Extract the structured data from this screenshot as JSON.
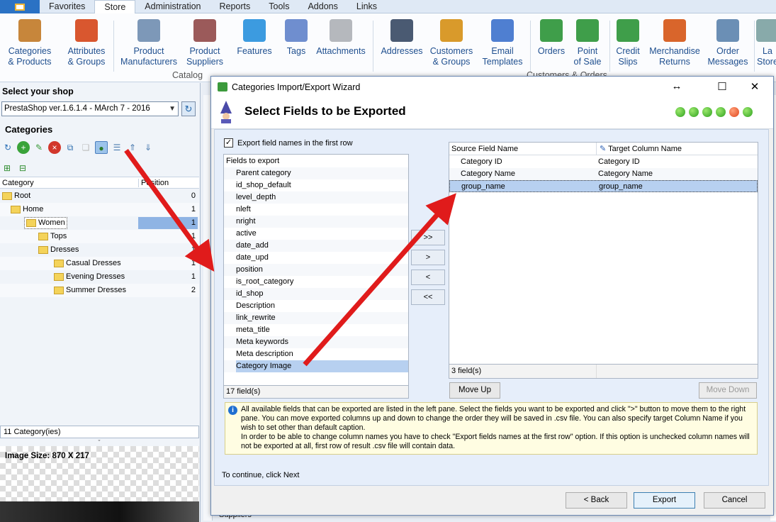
{
  "menubar": {
    "tabs": [
      "Favorites",
      "Store",
      "Administration",
      "Reports",
      "Tools",
      "Addons",
      "Links"
    ],
    "active": "Store"
  },
  "ribbon": {
    "buttons": [
      {
        "l1": "Categories",
        "l2": "& Products",
        "icon": "bag-icon",
        "color": "#c7863b"
      },
      {
        "l1": "Attributes",
        "l2": "& Groups",
        "icon": "blocks-icon",
        "color": "#d9572f"
      },
      {
        "l1": "Product",
        "l2": "Manufacturers",
        "icon": "building-icon",
        "color": "#7d98b8"
      },
      {
        "l1": "Product",
        "l2": "Suppliers",
        "icon": "store-icon",
        "color": "#9b5a5a"
      },
      {
        "l1": "Features",
        "l2": "",
        "icon": "cubes-icon",
        "color": "#3c9be0"
      },
      {
        "l1": "Tags",
        "l2": "",
        "icon": "tags-icon",
        "color": "#6f8ecf"
      },
      {
        "l1": "Attachments",
        "l2": "",
        "icon": "paperclip-icon",
        "color": "#b5b8bd"
      },
      {
        "l1": "Addresses",
        "l2": "",
        "icon": "addressbook-icon",
        "color": "#4a5a72"
      },
      {
        "l1": "Customers",
        "l2": "& Groups",
        "icon": "customers-icon",
        "color": "#d99a2b"
      },
      {
        "l1": "Email",
        "l2": "Templates",
        "icon": "email-icon",
        "color": "#4f7fd1"
      },
      {
        "l1": "Orders",
        "l2": "",
        "icon": "orders-icon",
        "color": "#3f9e4a"
      },
      {
        "l1": "Point",
        "l2": "of Sale",
        "icon": "pos-icon",
        "color": "#3f9e4a"
      },
      {
        "l1": "Credit",
        "l2": "Slips",
        "icon": "credit-icon",
        "color": "#3f9e4a"
      },
      {
        "l1": "Merchandise",
        "l2": "Returns",
        "icon": "returns-icon",
        "color": "#d9652b"
      },
      {
        "l1": "Order",
        "l2": "Messages",
        "icon": "messages-icon",
        "color": "#6b8fb5"
      },
      {
        "l1": "La",
        "l2": "Store",
        "icon": "more-icon",
        "color": "#8aa"
      }
    ],
    "groups": {
      "catalog": "Catalog",
      "customers": "Customers & Orders"
    }
  },
  "left": {
    "shop_label": "Select your shop",
    "shop_value": "PrestaShop ver.1.6.1.4 - MArch 7 - 2016",
    "cats_label": "Categories",
    "col_category": "Category",
    "col_position": "Position",
    "tree": [
      {
        "label": "Root",
        "pos": "0"
      },
      {
        "label": "Home",
        "pos": "1"
      },
      {
        "label": "Women",
        "pos": "1"
      },
      {
        "label": "Tops",
        "pos": "1"
      },
      {
        "label": "Dresses",
        "pos": "1"
      },
      {
        "label": "Casual Dresses",
        "pos": "1"
      },
      {
        "label": "Evening Dresses",
        "pos": "1"
      },
      {
        "label": "Summer Dresses",
        "pos": "2"
      }
    ],
    "count": "11 Category(ies)",
    "image_size": "Image Size: 870 X 217"
  },
  "bg": {
    "suppliers": "Suppliers"
  },
  "dialog": {
    "title": "Categories Import/Export Wizard",
    "header": "Select Fields to be Exported",
    "export_names_label": "Export field names in the  first row",
    "fields_header": "Fields to export",
    "fields": [
      "Parent category",
      "id_shop_default",
      "level_depth",
      "nleft",
      "nright",
      "active",
      "date_add",
      "date_upd",
      "position",
      "is_root_category",
      "id_shop",
      "Description",
      "link_rewrite",
      "meta_title",
      "Meta keywords",
      "Meta description",
      "Category Image"
    ],
    "fields_count": "17 field(s)",
    "move_buttons": [
      ">>",
      ">",
      "<",
      "<<"
    ],
    "col_source": "Source Field Name",
    "col_target": "Target Column Name",
    "selected": [
      {
        "source": "Category ID",
        "target": "Category ID"
      },
      {
        "source": "Category Name",
        "target": "Category Name"
      },
      {
        "source": "group_name",
        "target": "group_name"
      }
    ],
    "selected_count": "3 field(s)",
    "move_up": "Move Up",
    "move_down": "Move Down",
    "info_1": "All available fields that can be exported are listed in the left pane. Select the fields you want to be exported and click \">\" button to move them to the right pane. You can move exported columns up and down to change the order they will be saved in .csv file. You can also specify target Column Name if you wish to set other than default caption.",
    "info_2": "In order to be able to change column names you have to check \"Export fields names at the first row\" option. If this option is unchecked column names will not be exported at all, first row of result .csv file will contain data.",
    "continue": "To continue, click Next",
    "back": "< Back",
    "export": "Export",
    "cancel": "Cancel"
  }
}
